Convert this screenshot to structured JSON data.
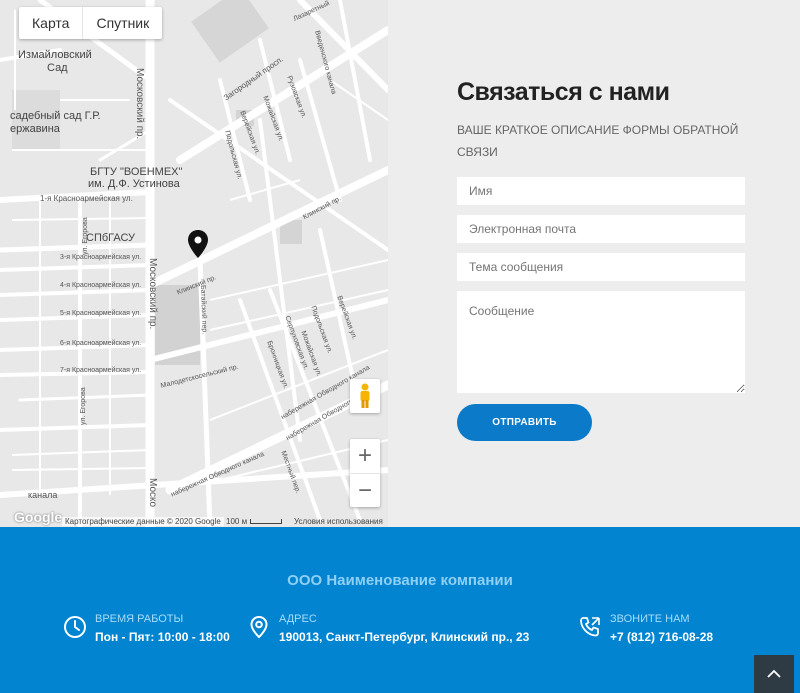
{
  "map": {
    "type_buttons": [
      "Карта",
      "Спутник"
    ],
    "labels": {
      "izm_1": "Измайловский",
      "izm_2": "Сад",
      "garden_1": "садебный сад Г.Р.",
      "garden_2": "ержавина",
      "bgtu_1": "БГТУ \"ВОЕНМЕХ\"",
      "bgtu_2": "им. Д.Ф. Устинова",
      "spbgasu": "СПбГАСУ",
      "krasn1": "1-я Красноармейская ул.",
      "krasn3": "3-я Красноармейская ул.",
      "krasn4": "4-я Красноармейская ул.",
      "krasn5": "5-я Красноармейская ул.",
      "krasn6": "6-я Красноармейская ул.",
      "krasn7": "7-я Красноармейская ул.",
      "moskovsky": "Московский пр.",
      "moskovsky2": "Московский пр.",
      "moskovsky3": "Моско",
      "zagorodny": "Загородный просп.",
      "lazaretny": "Лазаретный",
      "egorova": "ул. Егорова",
      "egorova2": "ул. Егорова",
      "obvodny1": "набережная Обводного канала",
      "obvodny2": "набережная Обводного канала",
      "obvodny3": "набережная Обводного канала",
      "kanala": "канала",
      "klinsky": "Клинский пр.",
      "klinsky2": "Клинский пр.",
      "batalny": "Батайский пер.",
      "malodetsk": "Малодетскосельский пр.",
      "mozhaiskaya": "Можайская ул.",
      "mozhaiskaya2": "Можайская ул.",
      "ruzovskaya": "Рузовская ул.",
      "podolskaya": "Подольская ул.",
      "podolskaya2": "Подольская ул.",
      "vereiskaya": "Верейская ул.",
      "vereiskaya2": "Верейская ул.",
      "serpukhovskaya": "Серпуховская ул.",
      "bronnitskaya": "Бронницкая ул.",
      "vvedenskogo": "Введенского канала",
      "mesnoy": "Местный пер."
    },
    "zoom_in": "+",
    "zoom_out": "−",
    "google": "Google",
    "attribution": "Картографические данные © 2020 Google",
    "scale": "100 м",
    "terms": "Условия использования"
  },
  "form": {
    "title": "Связаться с нами",
    "description": "ВАШЕ КРАТКОЕ ОПИСАНИЕ ФОРМЫ ОБРАТНОЙ СВЯЗИ",
    "name_placeholder": "Имя",
    "email_placeholder": "Электронная почта",
    "subject_placeholder": "Тема сообщения",
    "message_placeholder": "Сообщение",
    "submit_label": "ОТПРАВИТЬ"
  },
  "footer": {
    "company": "ООО Наименование компании",
    "hours": {
      "label": "ВРЕМЯ РАБОТЫ",
      "value": "Пон - Пят: 10:00 - 18:00"
    },
    "address": {
      "label": "АДРЕС",
      "value": "190013, Санкт-Петербург, Клинский пр., 23"
    },
    "phone": {
      "label": "ЗВОНИТЕ НАМ",
      "value": "+7 (812) 716-08-28"
    }
  },
  "colors": {
    "accent": "#0a7ac9",
    "footer_bg": "#0284d0",
    "company_text": "#8fd0f5"
  },
  "icons": [
    "clock-icon",
    "location-pin-icon",
    "phone-icon",
    "chevron-up-icon",
    "map-marker-icon",
    "pegman-icon"
  ]
}
